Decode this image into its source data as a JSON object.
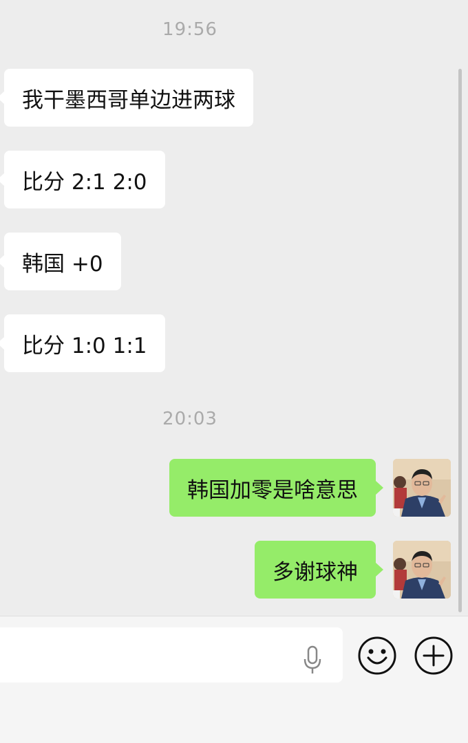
{
  "chat": {
    "timestamps": [
      "19:56",
      "20:03"
    ],
    "incoming": [
      {
        "text": "我干墨西哥单边进两球"
      },
      {
        "text": "比分 2:1 2:0"
      },
      {
        "text": "韩国 +0"
      },
      {
        "text": "比分 1:0 1:1"
      }
    ],
    "outgoing": [
      {
        "text": "韩国加零是啥意思"
      },
      {
        "text": "多谢球神"
      }
    ]
  },
  "input_bar": {
    "text_value": "",
    "icons": [
      "microphone-icon",
      "emoji-icon",
      "plus-icon"
    ]
  },
  "colors": {
    "background": "#ededed",
    "incoming_bubble": "#ffffff",
    "outgoing_bubble": "#95ec69"
  }
}
